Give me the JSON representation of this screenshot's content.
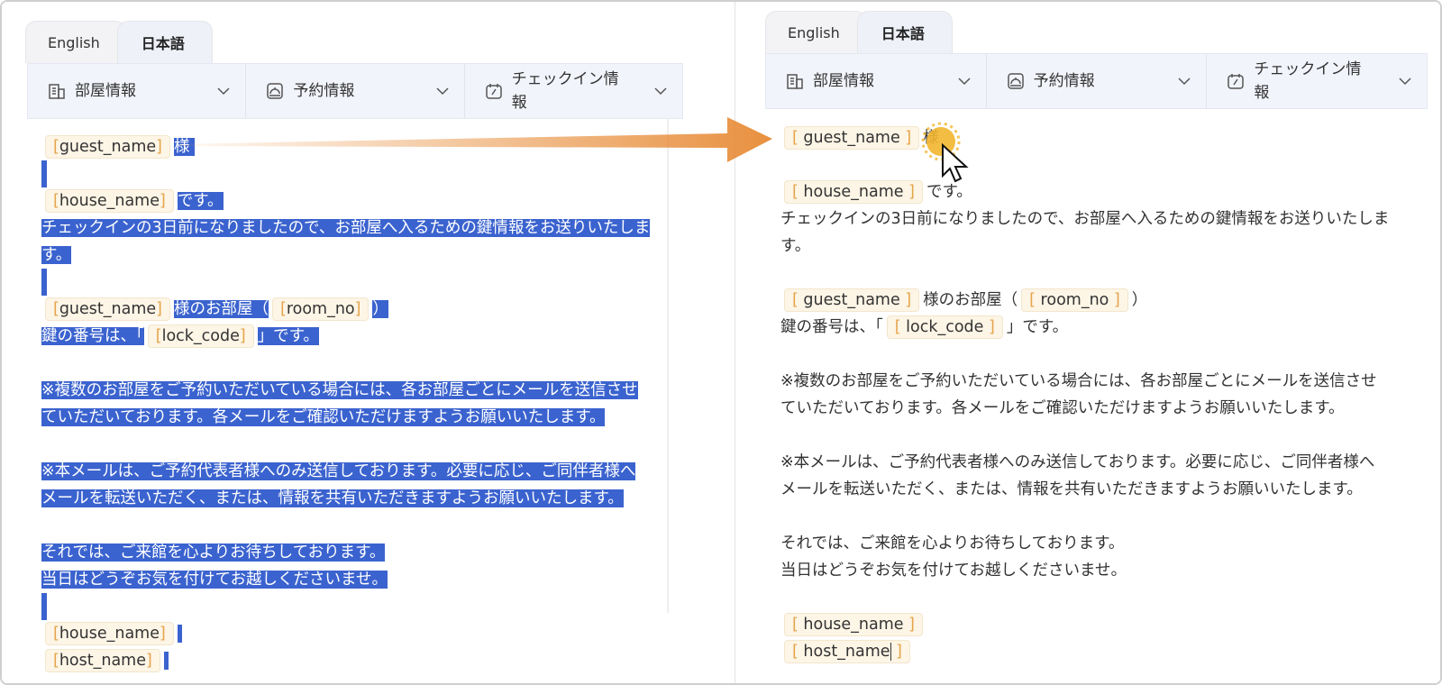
{
  "tabs": {
    "english": "English",
    "japanese": "日本語"
  },
  "toolbar": {
    "room_info": "部屋情報",
    "reservation_info": "予約情報",
    "checkin_info_l1": "チェックイン情",
    "checkin_info_l2": "報",
    "checkin_info_r1": "チェックイン情",
    "checkin_info_r2": "報"
  },
  "template": {
    "guest_name": "guest_name",
    "house_name": "house_name",
    "room_no": "room_no",
    "lock_code": "lock_code",
    "host_name": "host_name",
    "sama": "様",
    "desu": "です。",
    "line3a": "チェックインの3日前になりましたので、お部屋へ入るための鍵情報をお送りいたしま",
    "line3b": "す。",
    "room_prefix": "様のお部屋（",
    "room_suffix": "）",
    "lock_prefix": "鍵の番号は、「",
    "lock_suffix": "」です。",
    "note1a": "※複数のお部屋をご予約いただいている場合には、各お部屋ごとにメールを送信させ",
    "note1b": "ていただいております。各メールをご確認いただけますようお願いいたします。",
    "note2a": "※本メールは、ご予約代表者様へのみ送信しております。必要に応じ、ご同伴者様へ",
    "note2b": "メールを転送いただく、または、情報を共有いただきますようお願いいたします。",
    "closing1": "それでは、ご来館を心よりお待ちしております。",
    "closing2": "当日はどうぞお気を付けてお越しくださいませ。"
  },
  "colors": {
    "selection": "#3b63cf",
    "chip_bg": "#fdf5e6",
    "bracket": "#e5a54b",
    "arrow": "#e8903f",
    "toolbar_bg": "#f2f4fb"
  },
  "icons": [
    "building-icon",
    "reception-bell-icon",
    "calendar-checkin-icon",
    "chevron-down-icon",
    "arrow-right-icon",
    "mouse-cursor-icon"
  ]
}
